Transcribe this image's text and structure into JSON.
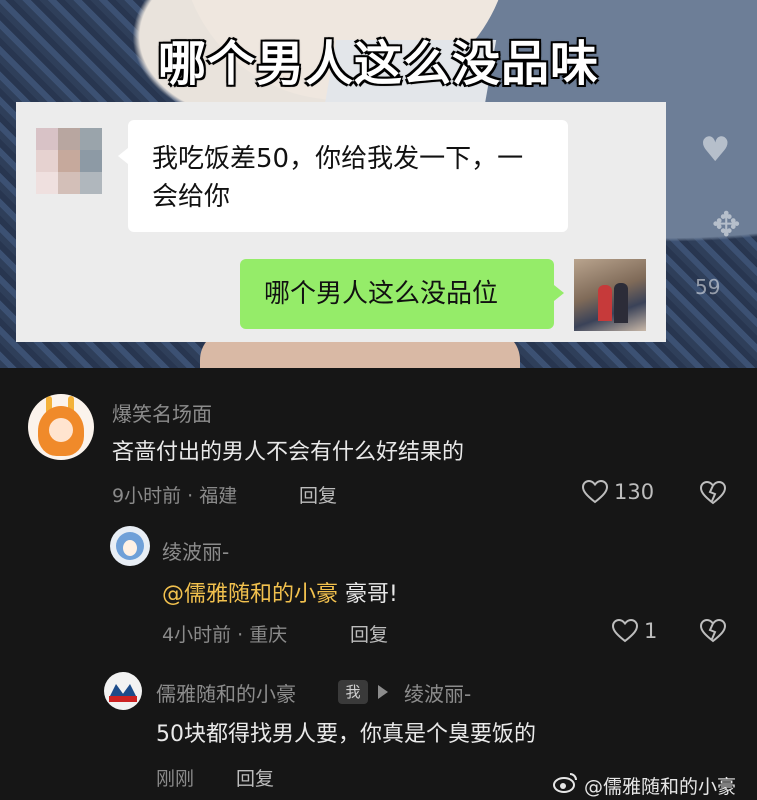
{
  "video": {
    "headline": "哪个男人这么没品味",
    "chat": {
      "left_message": "我吃饭差50，你给我发一下，一会给你",
      "right_message": "哪个男人这么没品位"
    },
    "overlay_number": "59"
  },
  "comments": [
    {
      "username": "爆笑名场面",
      "text": "吝啬付出的男人不会有什么好结果的",
      "time_location": "9小时前 · 福建",
      "reply_label": "回复",
      "likes": "130"
    },
    {
      "username": "绫波丽-",
      "mention": "@儒雅随和的小豪",
      "text_after_mention": " 豪哥!",
      "time_location": "4小时前 · 重庆",
      "reply_label": "回复",
      "likes": "1"
    },
    {
      "username": "儒雅随和的小豪",
      "me_badge": "我",
      "reply_to": "绫波丽-",
      "text": "50块都得找男人要，你真是个臭要饭的",
      "time": "刚刚",
      "reply_label": "回复"
    }
  ],
  "watermark": "@儒雅随和的小豪",
  "colors": {
    "background": "#161616",
    "mention": "#f2c14e",
    "wechat_green_bubble": "#95ec69"
  },
  "icons": [
    "heart-outline-icon",
    "dislike-heart-icon",
    "weibo-icon"
  ]
}
